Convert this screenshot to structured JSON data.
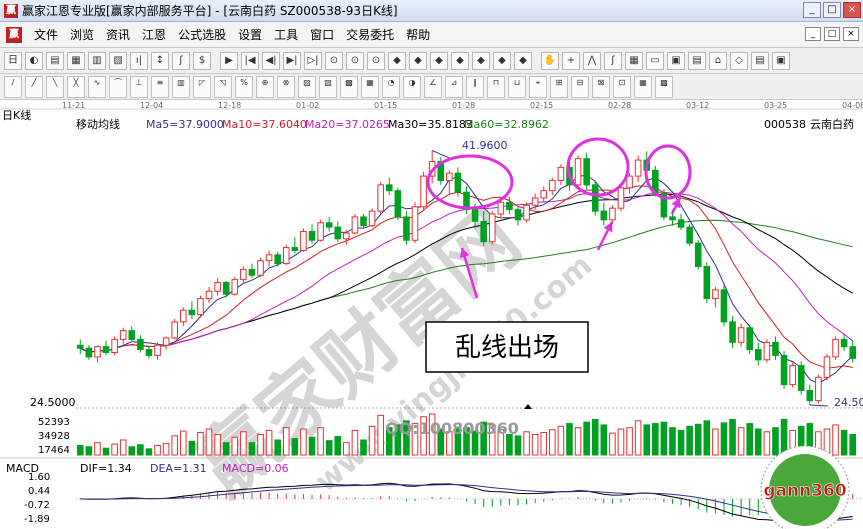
{
  "window": {
    "app_icon": "赢",
    "title": "赢家江恩专业版[赢家内部服务平台] - [云南白药  SZ000538-93日K线]",
    "buttons": {
      "minimize": "_",
      "maximize": "□",
      "close": "×"
    }
  },
  "menu": {
    "app_icon": "赢",
    "items": [
      "文件",
      "浏览",
      "资讯",
      "江恩",
      "公式选股",
      "设置",
      "工具",
      "窗口",
      "交易委托",
      "帮助"
    ],
    "mdi_buttons": [
      "_",
      "□",
      "×"
    ]
  },
  "toolbar1": {
    "leading": "日",
    "icons": 48
  },
  "toolbar2": {
    "icons": 40
  },
  "chart": {
    "panel_label": "日K线",
    "indicator_name": "移动均线",
    "ma_labels": {
      "ma5": "Ma5=37.9000",
      "ma10": "Ma10=37.6040",
      "ma20": "Ma20=37.0265",
      "ma30": "Ma30=35.8183",
      "ma60": "Ma60=32.8962"
    },
    "stock_code": "000538",
    "stock_name": "云南白药",
    "dates": [
      "11-21",
      "12-04",
      "12-18",
      "01-02",
      "01-15",
      "01-28",
      "02-15",
      "02-28",
      "03-12",
      "03-25",
      "04-08"
    ],
    "high_label": "41.9600",
    "low_label": "24.5000",
    "low_label_right": "24.50",
    "annotation_text": "乱线出场",
    "watermark_cn": "赢家财富网",
    "watermark_url": "www.yingjia360.com",
    "qq_text": "QQ:100800360",
    "colors": {
      "up": "#e83030",
      "down": "#00a020",
      "ma5": "#303090",
      "ma10": "#d02020",
      "ma20": "#c020c0",
      "ma30": "#000000",
      "ma60": "#208020",
      "annotation": "#e030e0"
    }
  },
  "volume": {
    "axis_labels": [
      "52393",
      "34928",
      "17464"
    ]
  },
  "macd": {
    "label": "MACD",
    "dif": "DIF=1.34",
    "dea": "DEA=1.31",
    "macd": "MACD=0.06",
    "axis_labels": [
      "1.60",
      "0.44",
      "-0.72",
      "-1.89"
    ]
  },
  "logo": {
    "text": "gann360"
  },
  "chart_data": {
    "type": "candlestick",
    "title": "",
    "series": [
      {
        "name": "Ma5"
      },
      {
        "name": "Ma10"
      },
      {
        "name": "Ma20"
      },
      {
        "name": "Ma30"
      },
      {
        "name": "Ma60"
      }
    ],
    "ohlc": [
      [
        28.6,
        29.0,
        28.0,
        28.4
      ],
      [
        28.4,
        28.6,
        27.6,
        27.8
      ],
      [
        27.8,
        28.6,
        27.4,
        28.5
      ],
      [
        28.5,
        28.9,
        27.9,
        28.1
      ],
      [
        28.1,
        29.2,
        27.9,
        29.0
      ],
      [
        29.0,
        29.8,
        28.7,
        29.6
      ],
      [
        29.6,
        29.9,
        28.8,
        29.0
      ],
      [
        29.0,
        29.3,
        28.1,
        28.3
      ],
      [
        28.3,
        28.5,
        27.7,
        27.9
      ],
      [
        27.9,
        28.8,
        27.6,
        28.6
      ],
      [
        28.6,
        29.2,
        28.3,
        29.1
      ],
      [
        29.1,
        30.4,
        29.0,
        30.2
      ],
      [
        30.2,
        31.2,
        29.9,
        31.0
      ],
      [
        31.0,
        31.6,
        30.4,
        30.7
      ],
      [
        30.7,
        32.0,
        30.5,
        31.8
      ],
      [
        31.8,
        32.6,
        31.5,
        32.3
      ],
      [
        32.3,
        33.2,
        32.0,
        32.9
      ],
      [
        32.9,
        33.0,
        31.9,
        32.1
      ],
      [
        32.1,
        33.3,
        32.0,
        33.1
      ],
      [
        33.1,
        34.0,
        32.8,
        33.8
      ],
      [
        33.8,
        34.2,
        33.2,
        33.4
      ],
      [
        33.4,
        34.6,
        33.3,
        34.4
      ],
      [
        34.4,
        35.1,
        34.0,
        34.8
      ],
      [
        34.8,
        35.0,
        34.0,
        34.2
      ],
      [
        34.2,
        35.5,
        34.1,
        35.3
      ],
      [
        35.3,
        36.0,
        34.9,
        35.1
      ],
      [
        35.1,
        36.6,
        35.0,
        36.4
      ],
      [
        36.4,
        36.9,
        35.6,
        35.8
      ],
      [
        35.8,
        37.2,
        35.7,
        37.0
      ],
      [
        37.0,
        37.4,
        36.4,
        36.7
      ],
      [
        36.7,
        37.1,
        35.7,
        35.9
      ],
      [
        35.9,
        36.5,
        35.5,
        36.3
      ],
      [
        36.3,
        37.6,
        36.2,
        37.4
      ],
      [
        37.4,
        37.6,
        36.6,
        36.8
      ],
      [
        36.8,
        38.0,
        36.7,
        37.8
      ],
      [
        37.8,
        39.8,
        37.6,
        39.6
      ],
      [
        39.6,
        40.1,
        38.9,
        39.2
      ],
      [
        39.2,
        39.4,
        37.2,
        37.4
      ],
      [
        37.4,
        37.8,
        35.5,
        35.8
      ],
      [
        35.8,
        38.4,
        35.6,
        38.1
      ],
      [
        38.1,
        40.5,
        37.9,
        40.2
      ],
      [
        40.2,
        41.96,
        39.7,
        41.2
      ],
      [
        41.2,
        41.5,
        39.6,
        39.9
      ],
      [
        39.9,
        40.6,
        39.0,
        40.4
      ],
      [
        40.4,
        40.8,
        38.8,
        39.1
      ],
      [
        39.1,
        39.5,
        37.6,
        37.9
      ],
      [
        37.9,
        38.3,
        36.6,
        37.1
      ],
      [
        37.1,
        37.8,
        35.4,
        35.7
      ],
      [
        35.7,
        37.8,
        35.5,
        37.6
      ],
      [
        37.6,
        38.6,
        37.3,
        38.4
      ],
      [
        38.4,
        38.8,
        37.6,
        37.9
      ],
      [
        37.9,
        38.1,
        36.8,
        37.2
      ],
      [
        37.2,
        38.4,
        37.0,
        38.2
      ],
      [
        38.2,
        39.0,
        37.9,
        38.7
      ],
      [
        38.7,
        39.5,
        38.4,
        39.2
      ],
      [
        39.2,
        40.1,
        38.9,
        39.9
      ],
      [
        39.9,
        41.0,
        39.6,
        40.8
      ],
      [
        40.8,
        41.2,
        39.2,
        39.6
      ],
      [
        39.6,
        41.6,
        39.4,
        41.4
      ],
      [
        41.4,
        41.8,
        39.3,
        39.6
      ],
      [
        39.6,
        39.9,
        37.5,
        37.8
      ],
      [
        37.8,
        38.4,
        36.8,
        37.2
      ],
      [
        37.2,
        38.2,
        36.9,
        38.0
      ],
      [
        38.0,
        39.6,
        37.8,
        39.4
      ],
      [
        39.4,
        40.4,
        39.0,
        40.2
      ],
      [
        40.2,
        41.6,
        39.8,
        41.3
      ],
      [
        41.3,
        41.9,
        40.3,
        40.6
      ],
      [
        40.6,
        40.9,
        38.8,
        39.0
      ],
      [
        39.0,
        39.3,
        37.2,
        37.4
      ],
      [
        37.4,
        37.9,
        36.8,
        37.2
      ],
      [
        37.2,
        37.6,
        36.5,
        36.7
      ],
      [
        36.7,
        36.9,
        35.4,
        35.6
      ],
      [
        35.6,
        35.8,
        33.8,
        34.0
      ],
      [
        34.0,
        34.3,
        31.5,
        31.8
      ],
      [
        31.8,
        32.6,
        31.2,
        32.4
      ],
      [
        32.4,
        32.7,
        29.9,
        30.2
      ],
      [
        30.2,
        30.6,
        28.4,
        28.8
      ],
      [
        28.8,
        30.1,
        28.5,
        29.8
      ],
      [
        29.8,
        30.0,
        28.0,
        28.3
      ],
      [
        28.3,
        28.8,
        27.2,
        27.6
      ],
      [
        27.6,
        29.0,
        27.4,
        28.8
      ],
      [
        28.8,
        29.2,
        27.6,
        27.9
      ],
      [
        27.9,
        28.2,
        25.6,
        25.9
      ],
      [
        25.9,
        27.4,
        25.7,
        27.2
      ],
      [
        27.2,
        27.5,
        25.2,
        25.5
      ],
      [
        25.5,
        25.9,
        24.5,
        24.8
      ],
      [
        24.8,
        26.6,
        24.6,
        26.4
      ],
      [
        26.4,
        28.0,
        26.2,
        27.8
      ],
      [
        27.8,
        29.2,
        27.6,
        29.0
      ],
      [
        29.0,
        29.3,
        28.2,
        28.5
      ],
      [
        28.5,
        28.9,
        27.4,
        27.7
      ]
    ],
    "volume": [
      14,
      12,
      18,
      10,
      16,
      22,
      12,
      15,
      9,
      14,
      17,
      28,
      35,
      20,
      33,
      38,
      30,
      18,
      26,
      34,
      18,
      30,
      36,
      22,
      40,
      24,
      38,
      26,
      40,
      21,
      27,
      18,
      36,
      22,
      42,
      58,
      40,
      44,
      50,
      46,
      56,
      60,
      38,
      34,
      41,
      40,
      35,
      48,
      44,
      37,
      30,
      28,
      34,
      30,
      33,
      37,
      42,
      46,
      40,
      48,
      52,
      44,
      32,
      38,
      40,
      50,
      44,
      46,
      48,
      40,
      36,
      42,
      45,
      50,
      38,
      47,
      52,
      40,
      46,
      38,
      34,
      40,
      52,
      36,
      42,
      46,
      34,
      38,
      44,
      36,
      30
    ],
    "ylim": [
      24.5,
      43.5
    ],
    "volume_ylim": [
      0,
      56000
    ],
    "macd_ylim": [
      -1.89,
      1.6
    ]
  }
}
